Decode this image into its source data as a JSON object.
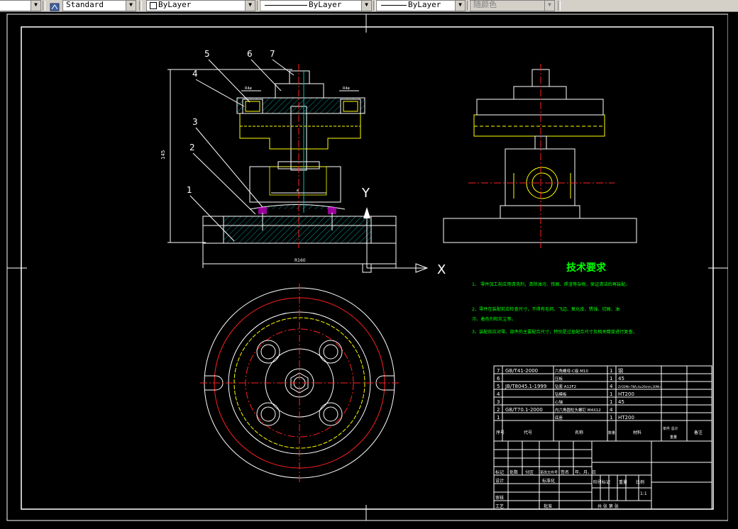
{
  "toolbar": {
    "text_style": "Standard",
    "layer": "ByLayer",
    "linetype": "ByLayer",
    "lineweight": "ByLayer",
    "plot_color": "随颜色"
  },
  "drawing": {
    "part_labels": [
      "1",
      "2",
      "3",
      "4",
      "5",
      "6",
      "7"
    ],
    "dimensions": {
      "height": "145",
      "width_bottom": "R160",
      "top_left": "R4ø",
      "top_right": "R4ø",
      "mid": "ø"
    },
    "ucs": {
      "x": "X",
      "y": "Y"
    },
    "tech_title": "技术要求",
    "tech_lines": [
      "1、 零件加工前应用清洗剂，清除油污、铁屑、焊渣等杂物，保证清洁后再装配。",
      "2、零件在装配前应检查尺寸，不得有毛刺、飞边、氧化皮、锈蚀、切屑、油",
      "污、着色剂和灰尘等。",
      "3、装配前应对零、部件的主要配合尺寸，特别是过盈配合尺寸及相关精度进行复查。"
    ],
    "bom": [
      {
        "no": "7",
        "std": "GB/T41-2000",
        "name": "六角螺母-C级 M10",
        "qty": "1",
        "mat": "钢"
      },
      {
        "no": "6",
        "std": "",
        "name": "压板",
        "qty": "1",
        "mat": "45"
      },
      {
        "no": "5",
        "std": "JB/T8045.1-1999",
        "name": "钻套 A12F2",
        "qty": "4",
        "mat": "ZrO2Mn-T8A,d≤26mm,20Mn"
      },
      {
        "no": "4",
        "std": "",
        "name": "钻模板",
        "qty": "1",
        "mat": "HT200"
      },
      {
        "no": "3",
        "std": "",
        "name": "心轴",
        "qty": "1",
        "mat": "45"
      },
      {
        "no": "2",
        "std": "GB/T70.1-2000",
        "name": "内六角圆柱头螺钉 M4X12",
        "qty": "4",
        "mat": ""
      },
      {
        "no": "1",
        "std": "",
        "name": "底座",
        "qty": "1",
        "mat": "HT200"
      }
    ],
    "bom_header": {
      "no": "序号",
      "std": "代号",
      "name": "名称",
      "qty": "数量",
      "mat": "材料",
      "weight": "单件 总计",
      "wlabel": "重量",
      "note": "备注"
    },
    "title_block": {
      "r1": [
        "标记",
        "处数",
        "分区",
        "更改文件号",
        "签名",
        "年、月、日"
      ],
      "design": "设计",
      "std": "标准化",
      "stage": "阶段标记",
      "weight": "重量",
      "scale": "比例",
      "scale_val": "1:1",
      "review": "审核",
      "process": "工艺",
      "approve": "批准",
      "sheets": "共  张  第  张"
    }
  }
}
